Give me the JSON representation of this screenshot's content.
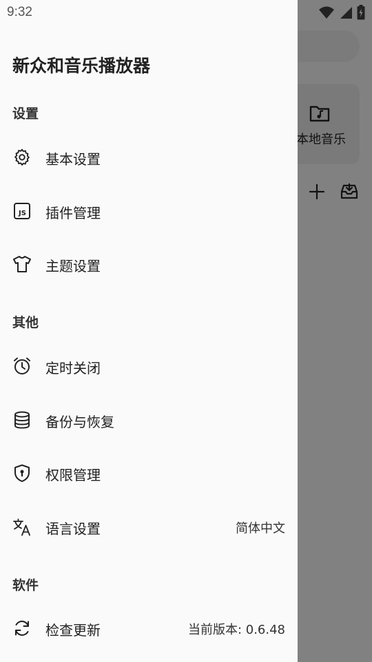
{
  "status_bar": {
    "time": "9:32"
  },
  "background": {
    "card_label": "本地音乐"
  },
  "drawer": {
    "title": "新众和音乐播放器",
    "sections": [
      {
        "header": "设置",
        "items": [
          {
            "label": "基本设置",
            "icon": "gear-icon"
          },
          {
            "label": "插件管理",
            "icon": "js-plugin-icon"
          },
          {
            "label": "主题设置",
            "icon": "tshirt-icon"
          }
        ]
      },
      {
        "header": "其他",
        "items": [
          {
            "label": "定时关闭",
            "icon": "alarm-clock-icon"
          },
          {
            "label": "备份与恢复",
            "icon": "database-icon"
          },
          {
            "label": "权限管理",
            "icon": "shield-lock-icon"
          },
          {
            "label": "语言设置",
            "icon": "translate-icon",
            "value": "简体中文"
          }
        ]
      },
      {
        "header": "软件",
        "items": [
          {
            "label": "检查更新",
            "icon": "refresh-icon",
            "value": "当前版本: 0.6.48"
          }
        ]
      }
    ]
  },
  "colors": {
    "drawer_bg": "#fafafa",
    "scrim": "#8a8a8a",
    "text_primary": "#222222"
  }
}
